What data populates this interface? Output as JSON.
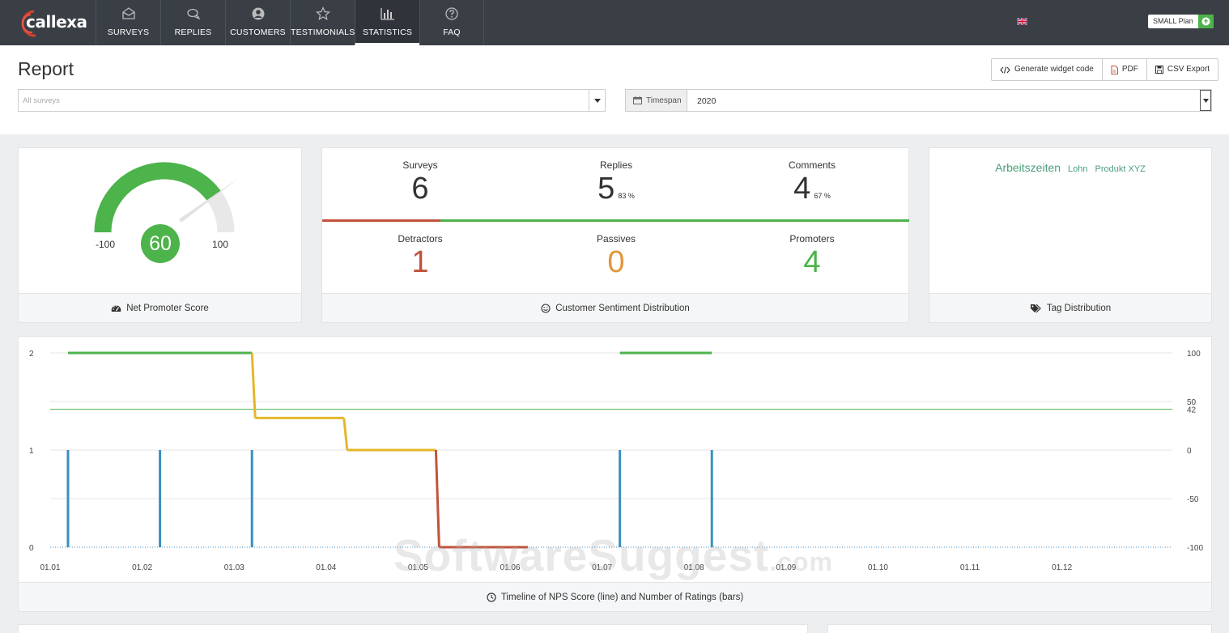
{
  "brand": {
    "name": "callexa"
  },
  "nav": [
    {
      "label": "SURVEYS",
      "icon": "envelope-icon"
    },
    {
      "label": "REPLIES",
      "icon": "comments-icon"
    },
    {
      "label": "CUSTOMERS",
      "icon": "user-circle-icon"
    },
    {
      "label": "TESTIMONIALS",
      "icon": "star-icon"
    },
    {
      "label": "STATISTICS",
      "icon": "bar-chart-icon",
      "active": true
    },
    {
      "label": "FAQ",
      "icon": "question-circle-icon"
    }
  ],
  "plan": {
    "label": "SMALL Plan"
  },
  "report": {
    "title": "Report",
    "buttons": {
      "widget": "Generate widget code",
      "pdf": "PDF",
      "csv": "CSV Export"
    },
    "surveys_placeholder": "All surveys",
    "timespan_label": "Timespan",
    "timespan_value": "2020"
  },
  "nps": {
    "score": "60",
    "min": "-100",
    "max": "100",
    "footer": "Net Promoter Score",
    "score_value": 60
  },
  "sentiment": {
    "surveys": {
      "label": "Surveys",
      "value": "6"
    },
    "replies": {
      "label": "Replies",
      "value": "5",
      "pct": "83 %"
    },
    "comments": {
      "label": "Comments",
      "value": "4",
      "pct": "67 %"
    },
    "detractors": {
      "label": "Detractors",
      "value": "1"
    },
    "passives": {
      "label": "Passives",
      "value": "0"
    },
    "promoters": {
      "label": "Promoters",
      "value": "4"
    },
    "footer": "Customer Sentiment Distribution"
  },
  "tags": {
    "items": [
      "Arbeitszeiten",
      "Lohn",
      "Produkt XYZ"
    ],
    "footer": "Tag Distribution"
  },
  "timeline": {
    "footer": "Timeline of NPS Score (line) and Number of Ratings (bars)"
  },
  "colors": {
    "green": "#4db34b",
    "red": "#c0533c",
    "orange": "#e0963a",
    "yellow": "#e5b62a",
    "blue": "#3a8fc0",
    "nav_bg": "#3a3f46"
  },
  "watermark": {
    "main": "SoftwareSuggest",
    "suffix": ".com"
  },
  "chart_data": {
    "type": "line",
    "x_ticks": [
      "01.01",
      "01.02",
      "01.03",
      "01.04",
      "01.05",
      "01.06",
      "01.07",
      "01.08",
      "01.09",
      "01.10",
      "01.11",
      "01.12"
    ],
    "left_axis": {
      "ticks": [
        0,
        1,
        2
      ],
      "ylim": [
        0,
        2
      ]
    },
    "right_axis": {
      "ticks": [
        -100,
        -50,
        0,
        50,
        100
      ],
      "ylim": [
        -100,
        100
      ]
    },
    "reference_line": {
      "value": 42,
      "label": "42"
    },
    "nps_line": [
      {
        "from": "01.01",
        "to": "01.03",
        "value": 100
      },
      {
        "from": "01.03",
        "to": "01.04",
        "value": 33
      },
      {
        "from": "01.04",
        "to": "01.05",
        "value": 0
      },
      {
        "from": "01.05",
        "to": "01.06",
        "value": -100
      },
      {
        "from": "01.07",
        "to": "01.08",
        "value": 100
      }
    ],
    "rating_bars": [
      {
        "x": "01.01",
        "value": 1
      },
      {
        "x": "01.02",
        "value": 1
      },
      {
        "x": "01.03",
        "value": 1
      },
      {
        "x": "01.07",
        "value": 1
      },
      {
        "x": "01.08",
        "value": 1
      }
    ]
  }
}
